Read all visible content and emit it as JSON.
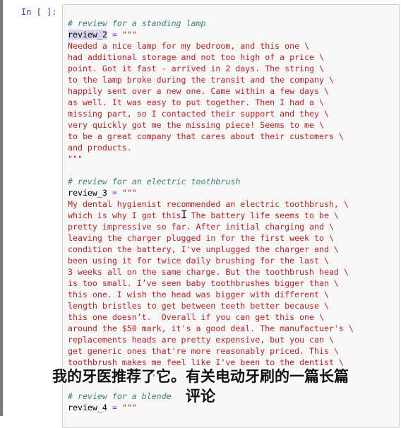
{
  "prompt": "In [ ]:",
  "code_lines": [
    {
      "kind": "comment",
      "text": "# review for a standing lamp"
    },
    {
      "kind": "assign",
      "var": "review_2",
      "highlight": true,
      "op": " = ",
      "str": "\"\"\""
    },
    {
      "kind": "string",
      "text": "Needed a nice lamp for my bedroom, and this one \\"
    },
    {
      "kind": "string",
      "text": "had additional storage and not too high of a price \\"
    },
    {
      "kind": "string",
      "text": "point. Got it fast - arrived in 2 days. The string \\"
    },
    {
      "kind": "string",
      "text": "to the lamp broke during the transit and the company \\"
    },
    {
      "kind": "string",
      "text": "happily sent over a new one. Came within a few days \\"
    },
    {
      "kind": "string",
      "text": "as well. It was easy to put together. Then I had a \\"
    },
    {
      "kind": "string",
      "text": "missing part, so I contacted their support and they \\"
    },
    {
      "kind": "string",
      "text": "very quickly got me the missing piece! Seems to me \\"
    },
    {
      "kind": "string",
      "text": "to be a great company that cares about their customers \\"
    },
    {
      "kind": "string",
      "text": "and products."
    },
    {
      "kind": "string",
      "text": "\"\"\""
    },
    {
      "kind": "blank",
      "text": ""
    },
    {
      "kind": "comment",
      "text": "# review for an electric toothbrush"
    },
    {
      "kind": "assign",
      "var": "review_3",
      "highlight": false,
      "op": " = ",
      "str": "\"\"\""
    },
    {
      "kind": "string",
      "text": "My dental hygienist recommended an electric toothbrush, \\"
    },
    {
      "kind": "string",
      "text": "which is why I got this. The battery life seems to be \\"
    },
    {
      "kind": "string",
      "text": "pretty impressive so far. After initial charging and \\"
    },
    {
      "kind": "string",
      "text": "leaving the charger plugged in for the first week to \\"
    },
    {
      "kind": "string",
      "text": "condition the battery, I've unplugged the charger and \\"
    },
    {
      "kind": "string",
      "text": "been using it for twice daily brushing for the last \\"
    },
    {
      "kind": "string",
      "text": "3 weeks all on the same charge. But the toothbrush head \\"
    },
    {
      "kind": "string",
      "text": "is too small. I’ve seen baby toothbrushes bigger than \\"
    },
    {
      "kind": "string",
      "text": "this one. I wish the head was bigger with different \\"
    },
    {
      "kind": "string",
      "text": "length bristles to get between teeth better because \\"
    },
    {
      "kind": "string",
      "text": "this one doesn’t.  Overall if you can get this one \\"
    },
    {
      "kind": "string",
      "text": "around the $50 mark, it's a good deal. The manufactuer's \\"
    },
    {
      "kind": "string",
      "text": "replacements heads are pretty expensive, but you can \\"
    },
    {
      "kind": "string",
      "text": "get generic ones that're more reasonably priced. This \\"
    },
    {
      "kind": "string",
      "text": "toothbrush makes me feel like I've been to the dentist \\"
    },
    {
      "kind": "string",
      "text": "every day. I h   f"
    },
    {
      "kind": "blank",
      "text": ""
    },
    {
      "kind": "comment",
      "text": "# review for a blende"
    },
    {
      "kind": "assign",
      "var": "review_4",
      "highlight": false,
      "op": " = ",
      "str": "\"\"\""
    }
  ],
  "subtitle": {
    "line1": "我的牙医推荐了它。有关电动牙刷的一篇长篇",
    "line2": "评论"
  },
  "colors": {
    "comment": "#408080",
    "string": "#ba2121",
    "operator": "#aa22ff",
    "prompt": "#303f9f",
    "cell_background": "#f7f7f7",
    "selection": "#d7d4f0"
  },
  "icons": {
    "text_cursor": "ibeam-cursor-icon"
  }
}
